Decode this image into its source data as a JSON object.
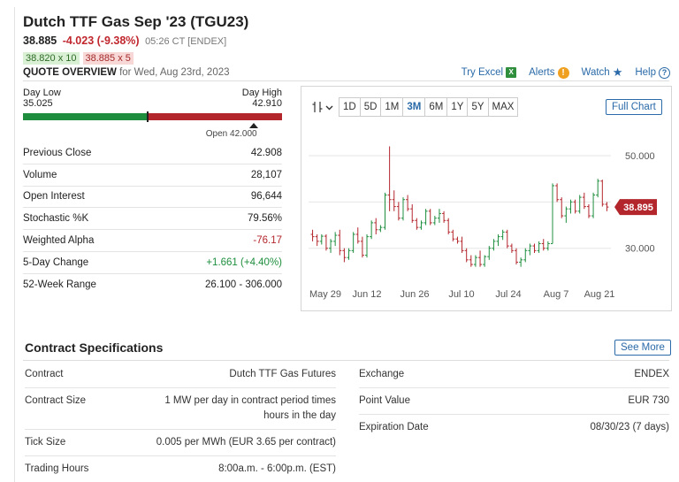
{
  "header": {
    "title": "Dutch TTF Gas Sep '23 (TGU23)",
    "last": "38.885",
    "change": "-4.023 (-9.38%)",
    "time": "05:26 CT [ENDEX]",
    "bid": "38.820 x 10",
    "ask": "38.885 x 5",
    "overview_label": "QUOTE OVERVIEW",
    "overview_date": "for Wed, Aug 23rd, 2023"
  },
  "tools": {
    "excel": "Try Excel",
    "excel_icon": "excel-icon",
    "alerts": "Alerts",
    "alert_icon": "alert-icon",
    "watch": "Watch",
    "watch_icon": "star-icon",
    "help": "Help",
    "help_icon": "help-icon"
  },
  "range": {
    "day_low_label": "Day Low",
    "day_low": "35.025",
    "day_high_label": "Day High",
    "day_high": "42.910",
    "current_fraction": 0.48,
    "open_fraction": 0.89,
    "open_label": "Open 42.000",
    "color_low": "#1e8e3e",
    "color_high": "#b3262c"
  },
  "stats": [
    {
      "label": "Previous Close",
      "value": "42.908",
      "tone": ""
    },
    {
      "label": "Volume",
      "value": "28,107",
      "tone": ""
    },
    {
      "label": "Open Interest",
      "value": "96,644",
      "tone": ""
    },
    {
      "label": "Stochastic %K",
      "value": "79.56%",
      "tone": ""
    },
    {
      "label": "Weighted Alpha",
      "value": "-76.17",
      "tone": "neg"
    },
    {
      "label": "5-Day Change",
      "value": "+1.661 (+4.40%)",
      "tone": "pos"
    },
    {
      "label": "52-Week Range",
      "value": "26.100 - 306.000",
      "tone": ""
    }
  ],
  "chart_toolbar": {
    "type_icon": "candlestick-icon",
    "periods": [
      "1D",
      "5D",
      "1M",
      "3M",
      "6M",
      "1Y",
      "5Y",
      "MAX"
    ],
    "active_period": "3M",
    "full_chart": "Full Chart"
  },
  "chart_data": {
    "type": "candlestick",
    "x_ticks": [
      "May 29",
      "Jun 12",
      "Jun 26",
      "Jul 10",
      "Jul 24",
      "Aug 7",
      "Aug 21"
    ],
    "y_ticks": [
      "50.000",
      "30.000"
    ],
    "ylim": [
      22.5,
      54
    ],
    "last_price_label": "38.895",
    "grid": true,
    "up_color": "#1e8e3e",
    "down_color": "#b3262c",
    "bars": [
      [
        33,
        34,
        31.5,
        32.5
      ],
      [
        32.5,
        33,
        30.5,
        31.5
      ],
      [
        31.5,
        33,
        30.8,
        32.6
      ],
      [
        32.6,
        33,
        29.5,
        30
      ],
      [
        30,
        32,
        29,
        31.5
      ],
      [
        31.5,
        33.5,
        30.5,
        32.8
      ],
      [
        32.8,
        34,
        28.5,
        29.5
      ],
      [
        29.5,
        30,
        27,
        28
      ],
      [
        28,
        30,
        27.5,
        29.5
      ],
      [
        29.5,
        33.5,
        29,
        33
      ],
      [
        33,
        34.5,
        31,
        31.5
      ],
      [
        31.5,
        32.5,
        28,
        28.5
      ],
      [
        28.5,
        33,
        28,
        32.5
      ],
      [
        32.5,
        36,
        32,
        35.5
      ],
      [
        35.5,
        36.5,
        33,
        34
      ],
      [
        34,
        35,
        33.5,
        34.5
      ],
      [
        34.5,
        42,
        34,
        41.5
      ],
      [
        41.5,
        52,
        38,
        40.5
      ],
      [
        40.5,
        42.5,
        38,
        39
      ],
      [
        39,
        40,
        36,
        36.5
      ],
      [
        36.5,
        41,
        36,
        40.5
      ],
      [
        40.5,
        41.5,
        38,
        38.5
      ],
      [
        38.5,
        39.5,
        35.5,
        36
      ],
      [
        36,
        36.5,
        34,
        34.5
      ],
      [
        34.5,
        36,
        34,
        35.5
      ],
      [
        35.5,
        38.5,
        35,
        38
      ],
      [
        38,
        38.5,
        35,
        35.5
      ],
      [
        35.5,
        37,
        35,
        36.5
      ],
      [
        36.5,
        38.5,
        35.5,
        37.5
      ],
      [
        37.5,
        38,
        35.5,
        36
      ],
      [
        36,
        36.5,
        33,
        33.5
      ],
      [
        33.5,
        34,
        31.5,
        32
      ],
      [
        32,
        32.5,
        31,
        31.5
      ],
      [
        31.5,
        32.5,
        29,
        29.5
      ],
      [
        29.5,
        30,
        27,
        27.5
      ],
      [
        27.5,
        28.5,
        26,
        26.5
      ],
      [
        26.5,
        28.5,
        26,
        28
      ],
      [
        28,
        29.5,
        26,
        26.5
      ],
      [
        26.5,
        28.5,
        26,
        28.2
      ],
      [
        28.2,
        30.5,
        27.5,
        30
      ],
      [
        30,
        32,
        29.5,
        31.5
      ],
      [
        31.5,
        33,
        30.5,
        32.5
      ],
      [
        32.5,
        34,
        31.8,
        33.5
      ],
      [
        33.5,
        34,
        30,
        30.5
      ],
      [
        30.5,
        31,
        29,
        29.5
      ],
      [
        29.5,
        30,
        26.5,
        27
      ],
      [
        27,
        28,
        26,
        27.5
      ],
      [
        27.5,
        30,
        27,
        29.5
      ],
      [
        29.5,
        31,
        28.5,
        30.5
      ],
      [
        30.5,
        31,
        29,
        29.5
      ],
      [
        29.5,
        31.5,
        29,
        31
      ],
      [
        31,
        32,
        29.5,
        30
      ],
      [
        30,
        31.5,
        29.5,
        31
      ],
      [
        31,
        44,
        31,
        43.5
      ],
      [
        43.5,
        44,
        40,
        40.5
      ],
      [
        40.5,
        41,
        36.5,
        37
      ],
      [
        37,
        39,
        35.5,
        38.5
      ],
      [
        38.5,
        40.5,
        37.5,
        40
      ],
      [
        40,
        40.5,
        37.5,
        38
      ],
      [
        38,
        41.5,
        37.5,
        41
      ],
      [
        41,
        42,
        38.5,
        39
      ],
      [
        39,
        39.5,
        36.5,
        37
      ],
      [
        37,
        42,
        36.5,
        41.5
      ],
      [
        41.5,
        45,
        41,
        44.5
      ],
      [
        44.5,
        44.8,
        39,
        39.5
      ],
      [
        39.5,
        40,
        38,
        38.9
      ]
    ]
  },
  "specs": {
    "title": "Contract Specifications",
    "see_more": "See More",
    "left": [
      {
        "label": "Contract",
        "value": "Dutch TTF Gas Futures"
      },
      {
        "label": "Contract Size",
        "value": "1 MW per day in contract period times hours in the day"
      },
      {
        "label": "Tick Size",
        "value": "0.005 per MWh (EUR 3.65 per contract)"
      },
      {
        "label": "Trading Hours",
        "value": "8:00a.m. - 6:00p.m. (EST)"
      }
    ],
    "right": [
      {
        "label": "Exchange",
        "value": "ENDEX"
      },
      {
        "label": "Point Value",
        "value": "EUR 730"
      },
      {
        "label": "Expiration Date",
        "value": "08/30/23 (7 days)"
      }
    ]
  }
}
